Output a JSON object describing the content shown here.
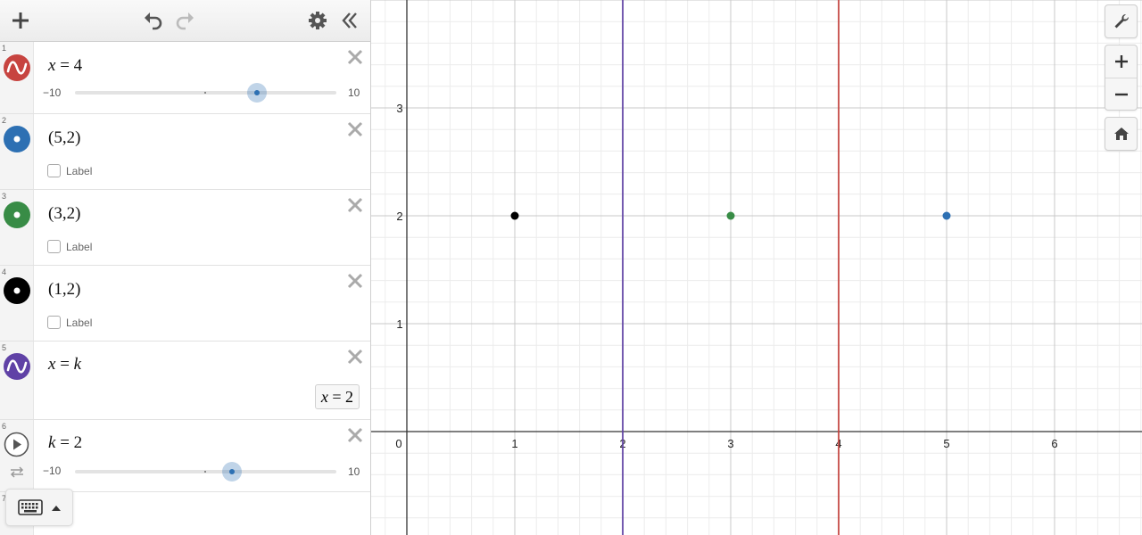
{
  "colors": {
    "red": "#c74440",
    "blue": "#2d70b3",
    "green": "#388c46",
    "black": "#000000",
    "purple": "#6042a6"
  },
  "toolbar": {
    "icons": [
      "add-icon",
      "undo-icon",
      "redo-icon",
      "gear-icon",
      "collapse-icon"
    ]
  },
  "expressions": [
    {
      "index": "1",
      "type": "slider-line",
      "color": "#c74440",
      "lhs": "x",
      "op": " = ",
      "rhs": "4",
      "slider": {
        "min": "−10",
        "max": "10",
        "value": 4
      }
    },
    {
      "index": "2",
      "type": "point",
      "color": "#2d70b3",
      "latex": "(5,2)",
      "label_text": "Label"
    },
    {
      "index": "3",
      "type": "point",
      "color": "#388c46",
      "latex": "(3,2)",
      "label_text": "Label"
    },
    {
      "index": "4",
      "type": "point",
      "color": "#000000",
      "latex": "(1,2)",
      "label_text": "Label"
    },
    {
      "index": "5",
      "type": "line",
      "color": "#6042a6",
      "lhs": "x",
      "op": " = ",
      "rhs": "k",
      "eval_lhs": "x",
      "eval_op": " = ",
      "eval_rhs": "2"
    },
    {
      "index": "6",
      "type": "slider",
      "lhs": "k",
      "op": " = ",
      "rhs": "2",
      "slider": {
        "min": "−10",
        "max": "10",
        "value": 2
      }
    },
    {
      "index": "7"
    }
  ],
  "graph": {
    "x_ticks": [
      "0",
      "1",
      "2",
      "3",
      "4",
      "5",
      "6"
    ],
    "y_ticks": [
      "1",
      "2",
      "3"
    ],
    "vertical_lines": [
      {
        "x": 2,
        "color": "#6042a6"
      },
      {
        "x": 4,
        "color": "#c74440"
      }
    ],
    "points": [
      {
        "x": 1,
        "y": 2,
        "color": "#000000"
      },
      {
        "x": 3,
        "y": 2,
        "color": "#388c46"
      },
      {
        "x": 5,
        "y": 2,
        "color": "#2d70b3"
      }
    ]
  },
  "controls": {
    "settings_icon": "wrench-icon",
    "zoom_in_icon": "zoom-in-icon",
    "zoom_out_icon": "zoom-out-icon",
    "home_icon": "home-icon"
  },
  "keyboard": {
    "icon": "keyboard-icon"
  }
}
